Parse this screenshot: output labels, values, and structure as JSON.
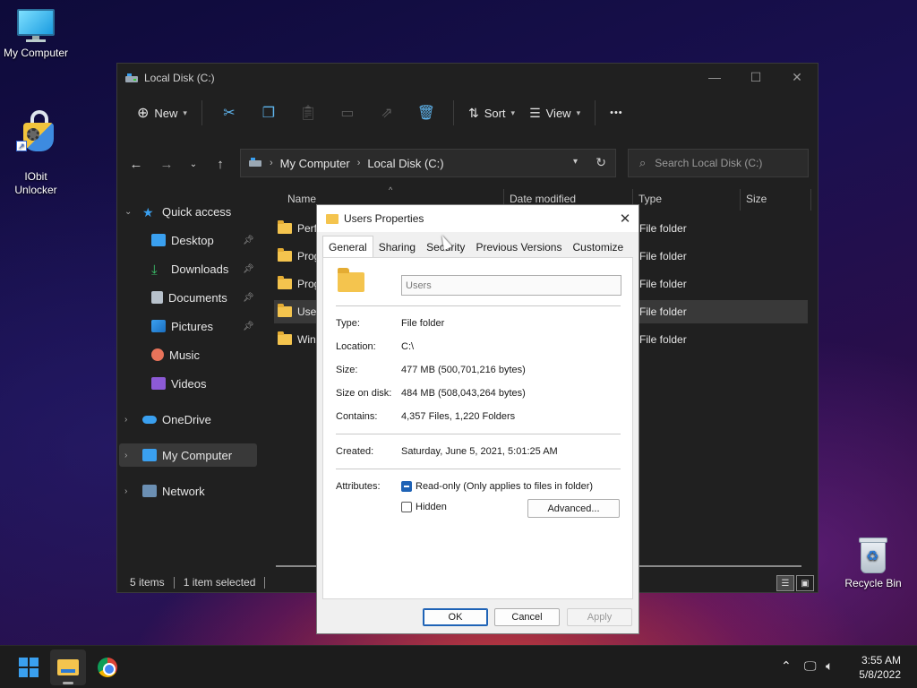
{
  "desktop": {
    "icons": [
      {
        "label": "My Computer"
      },
      {
        "label": "IObit\nUnlocker"
      },
      {
        "label": "Recycle Bin"
      }
    ]
  },
  "explorer": {
    "title": "Local Disk (C:)",
    "toolbar": {
      "new_label": "New",
      "sort_label": "Sort",
      "view_label": "View",
      "more_label": "•••"
    },
    "address": {
      "crumbs": [
        "My Computer",
        "Local Disk (C:)"
      ],
      "search_placeholder": "Search Local Disk (C:)"
    },
    "nav": {
      "quick_access": "Quick access",
      "items": [
        "Desktop",
        "Downloads",
        "Documents",
        "Pictures",
        "Music",
        "Videos"
      ],
      "onedrive": "OneDrive",
      "my_computer": "My Computer",
      "network": "Network"
    },
    "columns": {
      "name": "Name",
      "date": "Date modified",
      "type": "Type",
      "size": "Size"
    },
    "rows": [
      {
        "name": "PerfL",
        "type": "File folder",
        "selected": false
      },
      {
        "name": "Prog",
        "type": "File folder",
        "selected": false
      },
      {
        "name": "Prog",
        "type": "File folder",
        "selected": false
      },
      {
        "name": "Users",
        "type": "File folder",
        "selected": true
      },
      {
        "name": "Wind",
        "type": "File folder",
        "selected": false
      }
    ],
    "status": {
      "items": "5 items",
      "selected": "1 item selected"
    }
  },
  "dialog": {
    "title": "Users Properties",
    "tabs": [
      "General",
      "Sharing",
      "Security",
      "Previous Versions",
      "Customize"
    ],
    "active_tab": "General",
    "name_value": "Users",
    "props": {
      "type_label": "Type:",
      "type_value": "File folder",
      "location_label": "Location:",
      "location_value": "C:\\",
      "size_label": "Size:",
      "size_value": "477 MB (500,701,216 bytes)",
      "size_on_disk_label": "Size on disk:",
      "size_on_disk_value": "484 MB (508,043,264 bytes)",
      "contains_label": "Contains:",
      "contains_value": "4,357 Files, 1,220 Folders",
      "created_label": "Created:",
      "created_value": "Saturday, June 5, 2021, 5:01:25 AM",
      "attributes_label": "Attributes:",
      "readonly_label": "Read-only (Only applies to files in folder)",
      "hidden_label": "Hidden",
      "advanced_label": "Advanced..."
    },
    "buttons": {
      "ok": "OK",
      "cancel": "Cancel",
      "apply": "Apply"
    }
  },
  "taskbar": {
    "time": "3:55 AM",
    "date": "5/8/2022"
  },
  "colors": {
    "accent": "#1f63b6",
    "folder": "#f4c44e",
    "dark_bg": "#202020"
  }
}
